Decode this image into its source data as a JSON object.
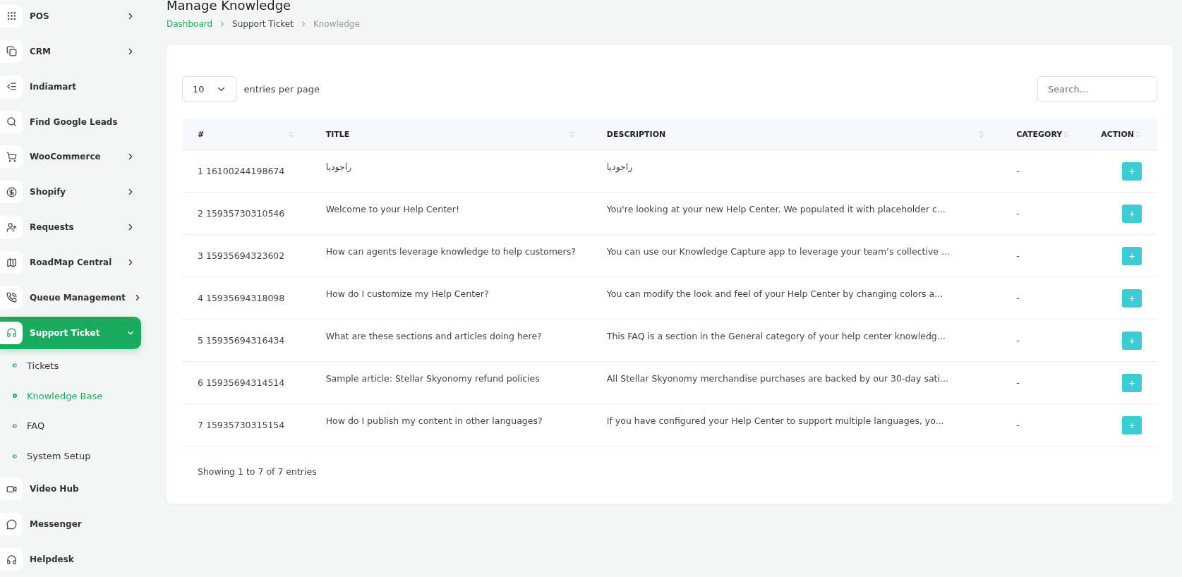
{
  "sidebar": {
    "items": [
      {
        "label": "POS",
        "expanded": false,
        "selected": false
      },
      {
        "label": "CRM",
        "expanded": false,
        "selected": false
      },
      {
        "label": "Indiamart",
        "selected": false
      },
      {
        "label": "Find Google Leads",
        "selected": false
      },
      {
        "label": "WooCommerce",
        "expanded": false,
        "selected": false
      },
      {
        "label": "Shopify",
        "expanded": false,
        "selected": false
      },
      {
        "label": "Requests",
        "expanded": false,
        "selected": false
      },
      {
        "label": "RoadMap Central",
        "expanded": false,
        "selected": false
      },
      {
        "label": "Queue Management",
        "expanded": false,
        "selected": false
      },
      {
        "label": "Support Ticket",
        "expanded": true,
        "selected": true,
        "children": [
          {
            "label": "Tickets",
            "selected": false
          },
          {
            "label": "Knowledge Base",
            "selected": true
          },
          {
            "label": "FAQ",
            "selected": false
          },
          {
            "label": "System Setup",
            "selected": false
          }
        ]
      },
      {
        "label": "Video Hub",
        "selected": false
      },
      {
        "label": "Messenger",
        "selected": false
      },
      {
        "label": "Helpdesk",
        "selected": false
      }
    ]
  },
  "page": {
    "title": "Manage Knowledge",
    "breadcrumbs": [
      "Dashboard",
      "Support Ticket",
      "Knowledge"
    ]
  },
  "table_controls": {
    "page_size": "10",
    "page_size_label": "entries per page",
    "search": {
      "placeholder": "Search..."
    }
  },
  "table": {
    "columns": [
      "#",
      "TITLE",
      "DESCRIPTION",
      "CATEGORY",
      "ACTION"
    ],
    "rows": [
      {
        "id": "1 16100244198674",
        "title": "راجوديا",
        "description": "راجوديا",
        "category": "-",
        "action": "+"
      },
      {
        "id": "2 15935730310546",
        "title": "Welcome to your Help Center!",
        "description": "You're looking at your new Help Center. We populated it with placeholder c...",
        "category": "-",
        "action": "+"
      },
      {
        "id": "3 15935694323602",
        "title": "How can agents leverage knowledge to help customers?",
        "description": "You can use our Knowledge Capture app to leverage your team’s collective ...",
        "category": "-",
        "action": "+"
      },
      {
        "id": "4 15935694318098",
        "title": "How do I customize my Help Center?",
        "description": "You can modify the look and feel of your Help Center by changing colors a...",
        "category": "-",
        "action": "+"
      },
      {
        "id": "5 15935694316434",
        "title": "What are these sections and articles doing here?",
        "description": "This FAQ is a section in the General category of your help center knowledg...",
        "category": "-",
        "action": "+"
      },
      {
        "id": "6 15935694314514",
        "title": "Sample article: Stellar Skyonomy refund policies",
        "description": "All Stellar Skyonomy merchandise purchases are backed by our 30-day sati...",
        "category": "-",
        "action": "+"
      },
      {
        "id": "7 15935730315154",
        "title": "How do I publish my content in other languages?",
        "description": "If you have configured your Help Center to support multiple languages, yo...",
        "category": "-",
        "action": "+"
      }
    ]
  },
  "footer": {
    "summary": "Showing 1 to 7 of 7 entries"
  }
}
